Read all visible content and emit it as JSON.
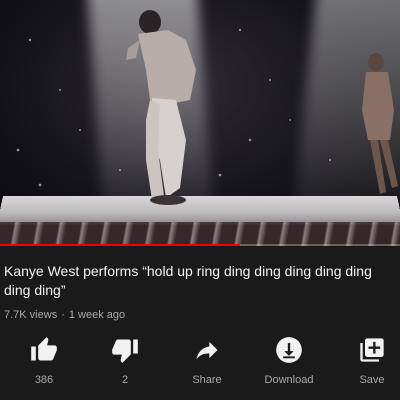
{
  "video": {
    "progress_fraction": 0.6,
    "title": "Kanye West performs “hold up ring ding ding ding ding ding ding ding”",
    "views": "7.7K views",
    "age": "1 week ago",
    "separator": "·"
  },
  "actions": {
    "like": {
      "icon": "thumbs-up-icon",
      "label": "386"
    },
    "dislike": {
      "icon": "thumbs-down-icon",
      "label": "2"
    },
    "share": {
      "icon": "share-arrow-icon",
      "label": "Share"
    },
    "download": {
      "icon": "download-icon",
      "label": "Download"
    },
    "save": {
      "icon": "add-to-playlist-icon",
      "label": "Save"
    }
  },
  "colors": {
    "background": "#1a1a1a",
    "progress": "#ee0000",
    "secondary_text": "#aaaaaa"
  }
}
